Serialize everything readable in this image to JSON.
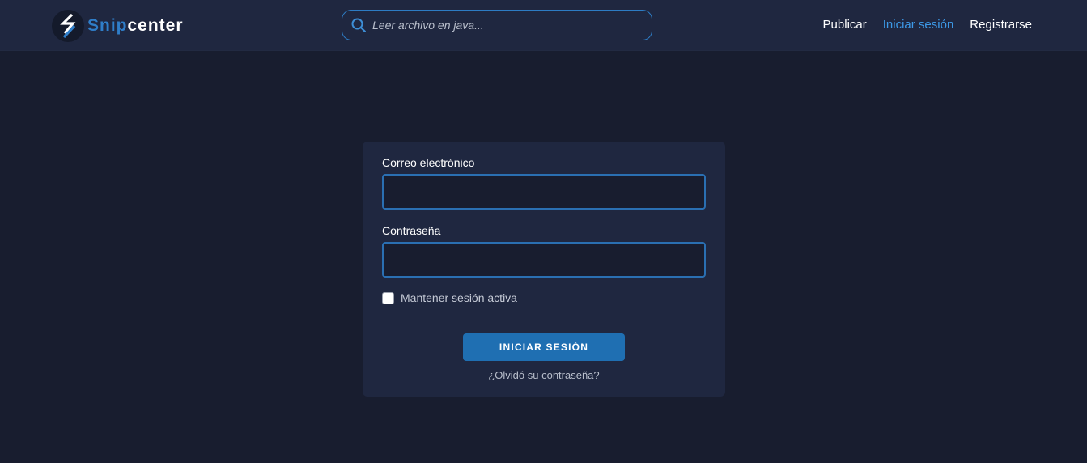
{
  "brand": {
    "name_part1": "Snip",
    "name_part2": "center",
    "logo_icon": "lightning-bolt-icon",
    "accent_color": "#2f7ec9"
  },
  "search": {
    "placeholder": "Leer archivo en java...",
    "value": "",
    "icon": "search-icon"
  },
  "nav": {
    "items": [
      {
        "label": "Publicar",
        "active": false
      },
      {
        "label": "Iniciar sesión",
        "active": true
      },
      {
        "label": "Registrarse",
        "active": false
      }
    ]
  },
  "login_form": {
    "email_label": "Correo electrónico",
    "email_value": "",
    "password_label": "Contraseña",
    "password_value": "",
    "remember_label": "Mantener sesión activa",
    "remember_checked": false,
    "submit_label": "INICIAR SESIÓN",
    "forgot_label": "¿Olvidó su contraseña?"
  }
}
